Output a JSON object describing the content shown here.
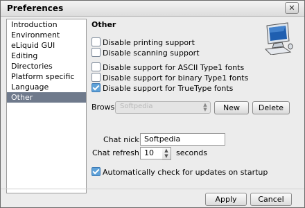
{
  "window": {
    "title": "Preferences",
    "close_glyph": "✕"
  },
  "sidebar": {
    "items": [
      {
        "label": "Introduction",
        "selected": false
      },
      {
        "label": "Environment",
        "selected": false
      },
      {
        "label": "eLiquid GUI",
        "selected": false
      },
      {
        "label": "Editing",
        "selected": false
      },
      {
        "label": "Directories",
        "selected": false
      },
      {
        "label": "Platform specific",
        "selected": false
      },
      {
        "label": "Language",
        "selected": false
      },
      {
        "label": "Other",
        "selected": true
      }
    ]
  },
  "panel": {
    "title": "Other",
    "icon": "computer-icon",
    "checkboxes": [
      {
        "label": "Disable printing support",
        "checked": false
      },
      {
        "label": "Disable scanning support",
        "checked": false
      },
      {
        "label": "Disable support for ASCII Type1 fonts",
        "checked": false
      },
      {
        "label": "Disable support for binary Type1 fonts",
        "checked": false
      },
      {
        "label": "Disable support for TrueType fonts",
        "checked": true
      }
    ],
    "browser": {
      "label": "Browser:",
      "value": "Softpedia",
      "new_label": "New",
      "delete_label": "Delete"
    },
    "chat_nick": {
      "label": "Chat nick:",
      "value": "Softpedia"
    },
    "chat_refresh": {
      "label": "Chat refresh:",
      "value": "10",
      "unit": "seconds"
    },
    "auto_update": {
      "label": "Automatically check for updates on startup",
      "checked": true
    }
  },
  "footer": {
    "apply_label": "Apply",
    "cancel_label": "Cancel"
  }
}
